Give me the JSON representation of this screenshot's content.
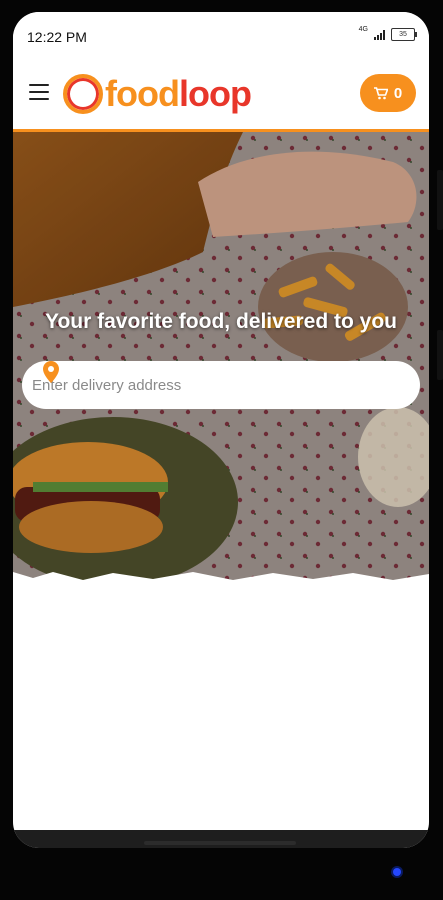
{
  "status_bar": {
    "time": "12:22 PM",
    "network": "4G",
    "battery": "35"
  },
  "header": {
    "menu_icon": "hamburger-menu-icon",
    "logo": {
      "part_a": "food",
      "part_b": "loop"
    },
    "cart": {
      "icon": "shopping-cart-icon",
      "count": "0"
    }
  },
  "hero": {
    "tagline": "Your favorite food, delivered to you",
    "search": {
      "placeholder": "Enter delivery address",
      "icon": "location-pin-icon"
    }
  },
  "colors": {
    "accent": "#f7901e",
    "brand_red": "#e8362a"
  }
}
